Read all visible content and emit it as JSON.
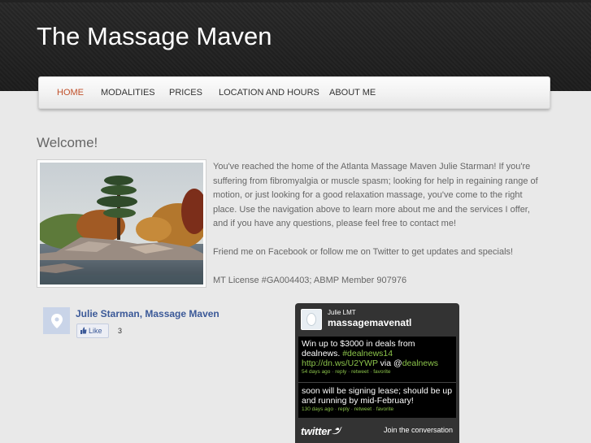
{
  "site": {
    "title": "The Massage Maven"
  },
  "nav": {
    "items": [
      {
        "label": "HOME",
        "active": true
      },
      {
        "label": "MODALITIES",
        "active": false
      },
      {
        "label": "PRICES",
        "active": false
      },
      {
        "label": "LOCATION AND HOURS",
        "active": false
      },
      {
        "label": "ABOUT ME",
        "active": false
      }
    ],
    "active_color": "#c0502a"
  },
  "main": {
    "heading": "Welcome!",
    "paragraphs": [
      "You've reached the home of the Atlanta Massage Maven Julie Starman!  If you're suffering from fibromyalgia or muscle spasm; looking for help in regaining range of motion, or just looking for a good relaxation massage, you've come to the right place. Use the navigation above to learn more about me and the services I offer, and if you have any questions, please feel free to contact me!",
      "Friend me on Facebook or follow me on Twitter to get updates and specials!",
      "MT License #GA004403; ABMP Member 907976"
    ]
  },
  "facebook": {
    "name": "Julie Starman, Massage Maven",
    "like_label": "Like",
    "like_count": "3",
    "icon": "map-pin-icon"
  },
  "twitter": {
    "real_name": "Julie LMT",
    "handle": "massagemavenatl",
    "tweets": [
      {
        "text_before": "Win up to $3000 in deals from dealnews. ",
        "hashtag": "#dealnews14",
        "link": "http://dn.ws/U2YWP",
        "via_text": " via @",
        "via_user": "dealnews",
        "age": "54 days ago",
        "reply": "reply",
        "retweet": "retweet",
        "favorite": "favorite"
      },
      {
        "text": "soon will be signing lease; should be up and running by mid-February!",
        "age": "130 days ago",
        "reply": "reply",
        "retweet": "retweet",
        "favorite": "favorite"
      }
    ],
    "logo_text": "twitter",
    "join_label": "Join the conversation"
  }
}
